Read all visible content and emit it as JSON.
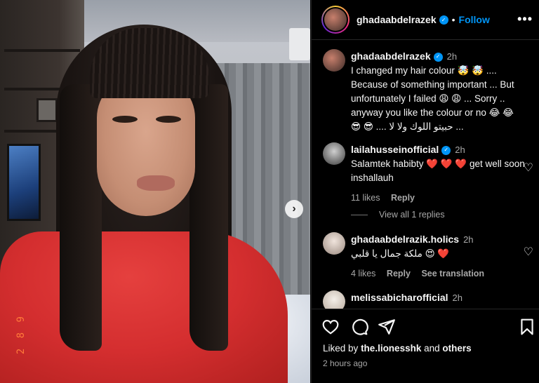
{
  "post": {
    "date_stamp": "2 8 9",
    "next_icon": "chevron-right-icon"
  },
  "header": {
    "username": "ghadaabdelrazek",
    "separator": "•",
    "follow_label": "Follow",
    "more_icon": "•••"
  },
  "caption": {
    "username": "ghadaabdelrazek",
    "time": "2h",
    "text": "I changed my hair colour 🤯 🤯 .... Because of something important ... But unfortunately I failed 😩 😩 ... Sorry .. anyway you like the colour or no 😂 😂 😎 😎 .... حبيتو اللوك ولا لا ..."
  },
  "comments": [
    {
      "username": "lailahusseinofficial",
      "time": "2h",
      "text": "Salamtek habibty ❤️ ❤️ ❤️ get well soon inshallauh",
      "likes": "11 likes",
      "reply": "Reply",
      "view_replies": "View all 1 replies"
    },
    {
      "username": "ghadaabdelrazik.holics",
      "time": "2h",
      "text": "ملكة جمال يا قلبي 😍 ❤️",
      "likes": "4 likes",
      "reply": "Reply",
      "translate": "See translation"
    },
    {
      "username": "melissabicharofficial",
      "time": "2h"
    }
  ],
  "footer": {
    "liked_prefix": "Liked by",
    "liked_user": "the.lionesshk",
    "liked_and": "and",
    "liked_others": "others",
    "time_ago": "2 hours ago"
  },
  "colors": {
    "accent": "#0095f6",
    "background": "#000000",
    "muted_text": "#a8a8a8"
  }
}
